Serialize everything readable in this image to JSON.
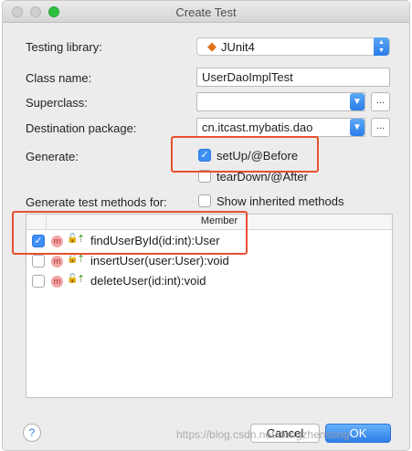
{
  "window": {
    "title": "Create Test"
  },
  "form": {
    "testing_library_label": "Testing library:",
    "testing_library_value": "JUnit4",
    "class_name_label": "Class name:",
    "class_name_value": "UserDaoImplTest",
    "superclass_label": "Superclass:",
    "superclass_value": "",
    "destination_label": "Destination package:",
    "destination_value": "cn.itcast.mybatis.dao",
    "browse_label": "...",
    "generate_label": "Generate:",
    "setup_label": "setUp/@Before",
    "setup_checked": true,
    "teardown_label": "tearDown/@After",
    "teardown_checked": false,
    "methods_label": "Generate test methods for:",
    "show_inherited_label": "Show inherited methods",
    "show_inherited_checked": false
  },
  "table": {
    "header": "Member",
    "rows": [
      {
        "label": "findUserById(id:int):User",
        "checked": true
      },
      {
        "label": "insertUser(user:User):void",
        "checked": false
      },
      {
        "label": "deleteUser(id:int):void",
        "checked": false
      }
    ]
  },
  "footer": {
    "help_label": "?",
    "cancel_label": "Cancel",
    "ok_label": "OK"
  },
  "watermark": "https://blog.csdn.net/dongzhensong",
  "colors": {
    "accent": "#2a7ce8",
    "highlight_box": "#e8502f"
  }
}
